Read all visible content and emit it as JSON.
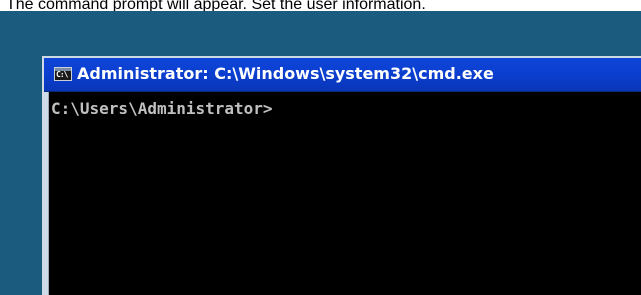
{
  "caption": {
    "text": "The command prompt will appear. Set the user information."
  },
  "window": {
    "title": "Administrator: C:\\Windows\\system32\\cmd.exe",
    "icon": "cmd-icon",
    "icon_glyph": "C:\\",
    "console": {
      "prompt": "C:\\Users\\Administrator>",
      "text_color": "#c0c0c0",
      "background_color": "#000000"
    }
  },
  "colors": {
    "desktop": "#1b5b7d",
    "titlebar": "#0b3fd0",
    "title_text": "#ffffff"
  }
}
